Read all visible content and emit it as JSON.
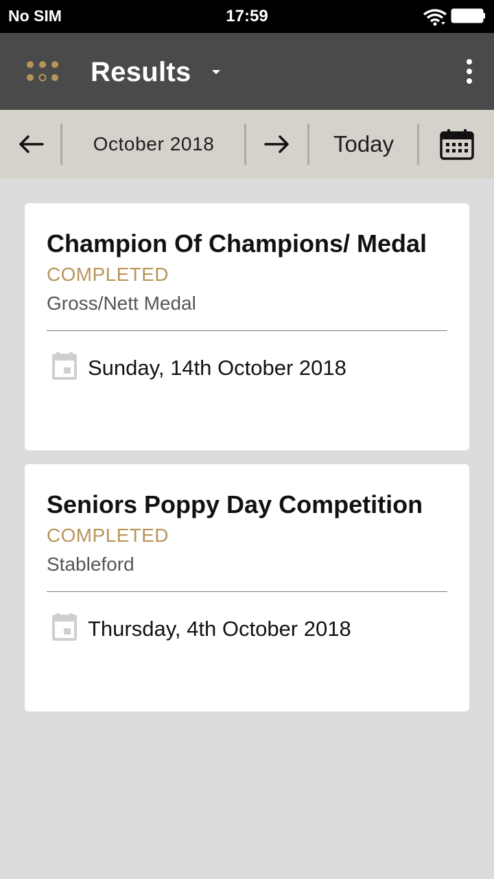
{
  "status_bar": {
    "carrier": "No SIM",
    "time": "17:59",
    "wifi_icon": "wifi-icon",
    "battery_icon": "battery-icon"
  },
  "app_bar": {
    "title": "Results",
    "menu_icon": "apps-grid-icon",
    "dropdown_icon": "caret-down-icon",
    "more_icon": "more-vert-icon"
  },
  "date_nav": {
    "prev_icon": "arrow-left-icon",
    "month": "October 2018",
    "next_icon": "arrow-right-icon",
    "today_label": "Today",
    "calendar_icon": "calendar-icon"
  },
  "colors": {
    "accent_gold": "#b8955a",
    "app_bar_bg": "#4a4a4a",
    "date_bar_bg": "#d6d2cb",
    "page_bg": "#dcdcdc"
  },
  "results": [
    {
      "title": "Champion Of Champions/ Medal",
      "status": "COMPLETED",
      "format": "Gross/Nett Medal",
      "date": "Sunday, 14th October 2018"
    },
    {
      "title": "Seniors Poppy Day Competition",
      "status": "COMPLETED",
      "format": "Stableford",
      "date": "Thursday, 4th October 2018"
    }
  ]
}
